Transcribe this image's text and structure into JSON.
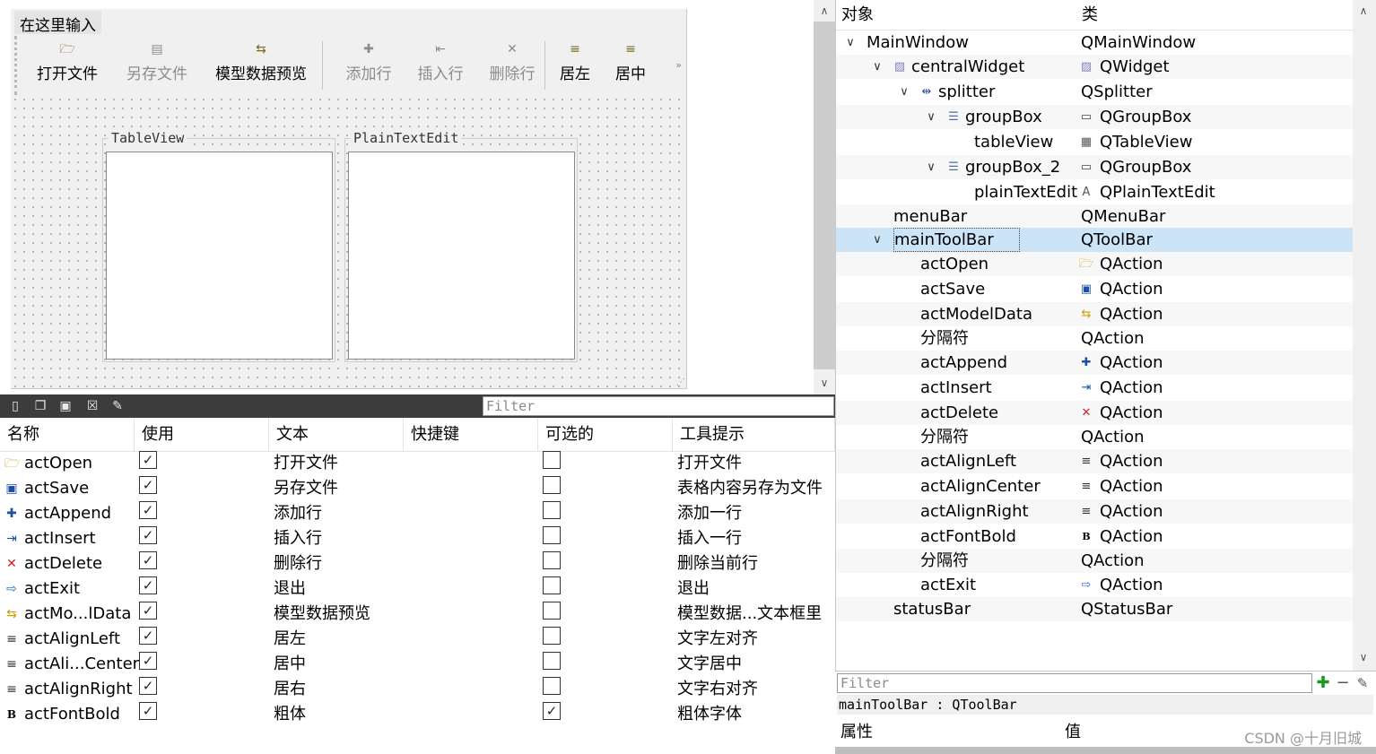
{
  "designer": {
    "menu_placeholder": "在这里输入",
    "toolbar": [
      {
        "icon": "folder-open-icon",
        "glyph": "🗁",
        "label": "打开文件",
        "enabled": true
      },
      {
        "icon": "save-icon",
        "glyph": "▤",
        "label": "另存文件",
        "enabled": false
      },
      {
        "icon": "model-data-icon",
        "glyph": "⇆",
        "label": "模型数据预览",
        "enabled": true
      },
      {
        "icon": "add-row-icon",
        "glyph": "✚",
        "label": "添加行",
        "enabled": false
      },
      {
        "icon": "insert-row-icon",
        "glyph": "⇤",
        "label": "插入行",
        "enabled": false
      },
      {
        "icon": "delete-row-icon",
        "glyph": "✕",
        "label": "删除行",
        "enabled": false
      },
      {
        "icon": "align-left-icon",
        "glyph": "≡",
        "label": "居左",
        "enabled": true
      },
      {
        "icon": "align-center-icon",
        "glyph": "≡",
        "label": "居中",
        "enabled": true
      }
    ],
    "toolbar_extension": "»",
    "groupbox1_title": "TableView",
    "groupbox2_title": "PlainTextEdit"
  },
  "action_editor": {
    "filter_placeholder": "Filter",
    "columns": [
      "名称",
      "使用",
      "文本",
      "快捷键",
      "可选的",
      "工具提示"
    ],
    "rows": [
      {
        "icon": "folder-open-icon",
        "glyph": "🗁",
        "color": "#c8a000",
        "name": "actOpen",
        "used": true,
        "text": "打开文件",
        "checkable": false,
        "tooltip": "打开文件"
      },
      {
        "icon": "save-icon",
        "glyph": "▣",
        "color": "#1f4fa0",
        "name": "actSave",
        "used": true,
        "text": "另存文件",
        "checkable": false,
        "tooltip": "表格内容另存为文件"
      },
      {
        "icon": "plus-icon",
        "glyph": "✚",
        "color": "#1f4fa0",
        "name": "actAppend",
        "used": true,
        "text": "添加行",
        "checkable": false,
        "tooltip": "添加一行"
      },
      {
        "icon": "insert-icon",
        "glyph": "⇥",
        "color": "#1f4fa0",
        "name": "actInsert",
        "used": true,
        "text": "插入行",
        "checkable": false,
        "tooltip": "插入一行"
      },
      {
        "icon": "delete-icon",
        "glyph": "✕",
        "color": "#d02020",
        "name": "actDelete",
        "used": true,
        "text": "删除行",
        "checkable": false,
        "tooltip": "删除当前行"
      },
      {
        "icon": "exit-icon",
        "glyph": "⇨",
        "color": "#3070c0",
        "name": "actExit",
        "used": true,
        "text": "退出",
        "checkable": false,
        "tooltip": "退出"
      },
      {
        "icon": "model-data-icon",
        "glyph": "⇆",
        "color": "#c8a000",
        "name": "actMo...lData",
        "used": true,
        "text": "模型数据预览",
        "checkable": false,
        "tooltip": "模型数据...文本框里"
      },
      {
        "icon": "align-left-icon",
        "glyph": "≡",
        "color": "#333333",
        "name": "actAlignLeft",
        "used": true,
        "text": "居左",
        "checkable": false,
        "tooltip": "文字左对齐"
      },
      {
        "icon": "align-center-icon",
        "glyph": "≡",
        "color": "#333333",
        "name": "actAli...Center",
        "used": true,
        "text": "居中",
        "checkable": false,
        "tooltip": "文字居中"
      },
      {
        "icon": "align-right-icon",
        "glyph": "≡",
        "color": "#333333",
        "name": "actAlignRight",
        "used": true,
        "text": "居右",
        "checkable": false,
        "tooltip": "文字右对齐"
      },
      {
        "icon": "bold-icon",
        "glyph": "B",
        "color": "#000000",
        "name": "actFontBold",
        "used": true,
        "text": "粗体",
        "checkable": true,
        "tooltip": "粗体字体"
      }
    ]
  },
  "object_inspector": {
    "columns": [
      "对象",
      "类"
    ],
    "rows": [
      {
        "depth": 0,
        "arrow": "∨",
        "name": "MainWindow",
        "class": "QMainWindow",
        "class_icon": ""
      },
      {
        "depth": 1,
        "arrow": "∨",
        "obj_icon": "widget-icon",
        "name": "centralWidget",
        "class": "QWidget",
        "class_icon": "widget-icon"
      },
      {
        "depth": 2,
        "arrow": "∨",
        "obj_icon": "splitter-icon",
        "name": "splitter",
        "class": "QSplitter",
        "class_icon": ""
      },
      {
        "depth": 3,
        "arrow": "∨",
        "obj_icon": "layout-icon",
        "name": "groupBox",
        "class": "QGroupBox",
        "class_icon": "groupbox-icon"
      },
      {
        "depth": 4,
        "arrow": "",
        "name": "tableView",
        "class": "QTableView",
        "class_icon": "tableview-icon"
      },
      {
        "depth": 3,
        "arrow": "∨",
        "obj_icon": "layout-icon",
        "name": "groupBox_2",
        "class": "QGroupBox",
        "class_icon": "groupbox-icon"
      },
      {
        "depth": 4,
        "arrow": "",
        "name": "plainTextEdit",
        "class": "QPlainTextEdit",
        "class_icon": "plaintextedit-icon"
      },
      {
        "depth": 1,
        "arrow": "",
        "name": "menuBar",
        "class": "QMenuBar",
        "class_icon": ""
      },
      {
        "depth": 1,
        "arrow": "∨",
        "name": "mainToolBar",
        "class": "QToolBar",
        "class_icon": "",
        "selected": true
      },
      {
        "depth": 2,
        "arrow": "",
        "name": "actOpen",
        "class": "QAction",
        "class_icon": "folder-open-icon"
      },
      {
        "depth": 2,
        "arrow": "",
        "name": "actSave",
        "class": "QAction",
        "class_icon": "save-icon"
      },
      {
        "depth": 2,
        "arrow": "",
        "name": "actModelData",
        "class": "QAction",
        "class_icon": "model-data-icon"
      },
      {
        "depth": 2,
        "arrow": "",
        "name": "分隔符",
        "class": "QAction",
        "class_icon": ""
      },
      {
        "depth": 2,
        "arrow": "",
        "name": "actAppend",
        "class": "QAction",
        "class_icon": "plus-icon"
      },
      {
        "depth": 2,
        "arrow": "",
        "name": "actInsert",
        "class": "QAction",
        "class_icon": "insert-icon"
      },
      {
        "depth": 2,
        "arrow": "",
        "name": "actDelete",
        "class": "QAction",
        "class_icon": "delete-icon"
      },
      {
        "depth": 2,
        "arrow": "",
        "name": "分隔符",
        "class": "QAction",
        "class_icon": ""
      },
      {
        "depth": 2,
        "arrow": "",
        "name": "actAlignLeft",
        "class": "QAction",
        "class_icon": "align-left-icon"
      },
      {
        "depth": 2,
        "arrow": "",
        "name": "actAlignCenter",
        "class": "QAction",
        "class_icon": "align-center-icon"
      },
      {
        "depth": 2,
        "arrow": "",
        "name": "actAlignRight",
        "class": "QAction",
        "class_icon": "align-right-icon"
      },
      {
        "depth": 2,
        "arrow": "",
        "name": "actFontBold",
        "class": "QAction",
        "class_icon": "bold-icon"
      },
      {
        "depth": 2,
        "arrow": "",
        "name": "分隔符",
        "class": "QAction",
        "class_icon": ""
      },
      {
        "depth": 2,
        "arrow": "",
        "name": "actExit",
        "class": "QAction",
        "class_icon": "exit-icon"
      },
      {
        "depth": 1,
        "arrow": "",
        "name": "statusBar",
        "class": "QStatusBar",
        "class_icon": ""
      }
    ]
  },
  "property_editor": {
    "filter_placeholder": "Filter",
    "object_label": "mainToolBar : QToolBar",
    "columns": [
      "属性",
      "值"
    ]
  },
  "watermark": "CSDN @十月旧城"
}
